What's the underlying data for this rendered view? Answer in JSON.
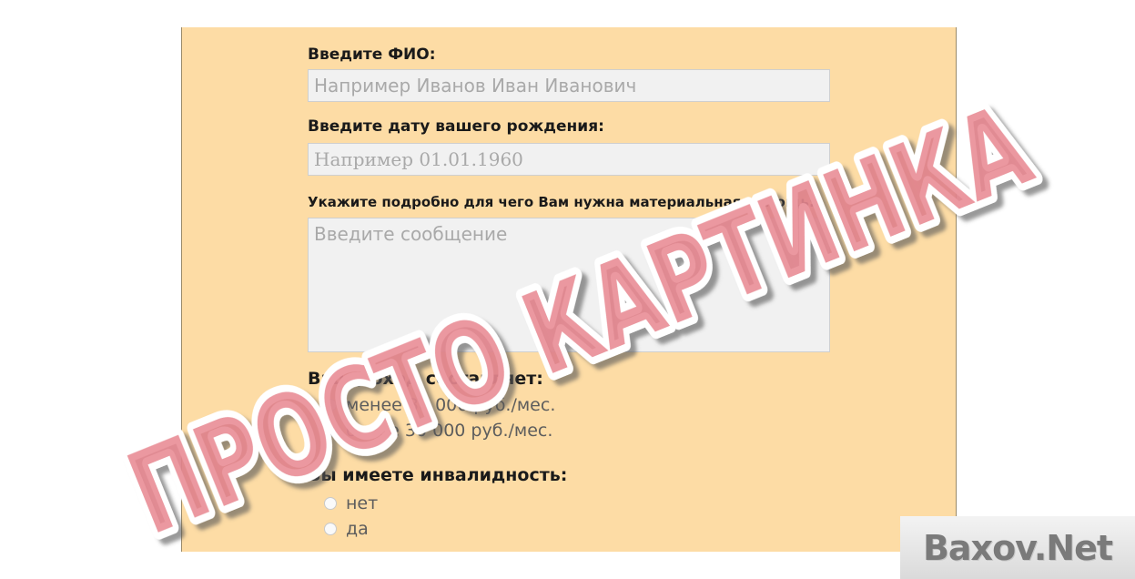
{
  "form": {
    "fio": {
      "label": "Введите ФИО:",
      "placeholder": "Например Иванов Иван Иванович"
    },
    "birthdate": {
      "label": "Введите дату вашего рождения:",
      "placeholder": "Например 01.01.1960"
    },
    "purpose": {
      "label": "Укажите подробно для чего Вам нужна материальная помощь:",
      "placeholder": "Введите сообщение"
    },
    "income": {
      "label": "Ваш доход составляет:",
      "options": [
        "менее 30 000 руб./мес.",
        "более 30 000 руб./мес."
      ]
    },
    "disability": {
      "label": "Вы имеете инвалидность:",
      "options": [
        "нет",
        "да"
      ]
    }
  },
  "watermark": {
    "text": "ПРОСТО КАРТИНКА",
    "color": "#e8868f"
  },
  "badge": {
    "text": "Baxov.Net"
  },
  "colors": {
    "panel": "#fddca5",
    "field_bg": "#f1f1f1",
    "placeholder": "#a9a9a9"
  }
}
